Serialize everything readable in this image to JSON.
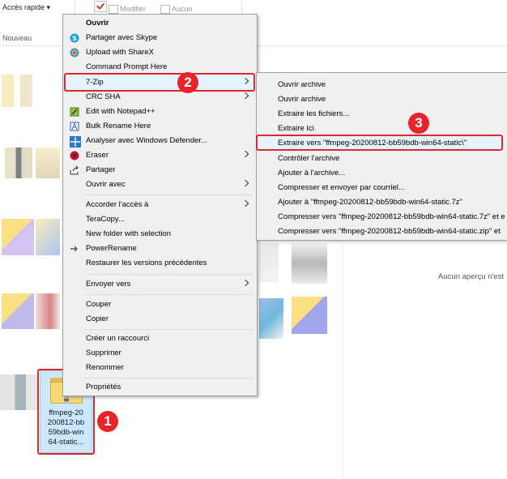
{
  "ribbon": {
    "quick_access": "Accès rapide ▾",
    "group_new": "Nouveau",
    "modifier": "Modifier",
    "aucun": "Aucun"
  },
  "preview": {
    "text": "Aucun aperçu n'est"
  },
  "selected_file": {
    "name_lines": [
      "ffmpeg-20",
      "200812-bb",
      "59bdb-win",
      "64-static..."
    ]
  },
  "badges": [
    "1",
    "2",
    "3"
  ],
  "context_menu": {
    "items": [
      {
        "label": "Ouvrir",
        "icon": "none",
        "bold": true
      },
      {
        "label": "Partager avec Skype",
        "icon": "skype-icon"
      },
      {
        "label": "Upload with ShareX",
        "icon": "sharex-icon"
      },
      {
        "label": "Command Prompt Here",
        "icon": "none"
      },
      {
        "label": "7-Zip",
        "icon": "none",
        "submenu": true
      },
      {
        "label": "CRC SHA",
        "icon": "none",
        "submenu": true
      },
      {
        "label": "Edit with Notepad++",
        "icon": "notepad-icon"
      },
      {
        "label": "Bulk Rename Here",
        "icon": "bulk-rename-icon"
      },
      {
        "label": "Analyser avec Windows Defender...",
        "icon": "defender-icon"
      },
      {
        "label": "Eraser",
        "icon": "eraser-icon",
        "submenu": true
      },
      {
        "label": "Partager",
        "icon": "share-icon"
      },
      {
        "label": "Ouvrir avec",
        "icon": "none",
        "submenu": true
      },
      {
        "label": "Accorder l'accès à",
        "icon": "none",
        "submenu": true
      },
      {
        "label": "TeraCopy...",
        "icon": "none"
      },
      {
        "label": "New folder with selection",
        "icon": "none"
      },
      {
        "label": "PowerRename",
        "icon": "powerrename-icon"
      },
      {
        "label": "Restaurer les versions précédentes",
        "icon": "none"
      },
      {
        "label": "Envoyer vers",
        "icon": "none",
        "submenu": true
      },
      {
        "label": "Couper",
        "icon": "none"
      },
      {
        "label": "Copier",
        "icon": "none"
      },
      {
        "label": "Créer un raccourci",
        "icon": "none"
      },
      {
        "label": "Supprimer",
        "icon": "none"
      },
      {
        "label": "Renommer",
        "icon": "none"
      },
      {
        "label": "Propriétés",
        "icon": "none"
      }
    ]
  },
  "submenu_7zip": {
    "items": [
      "Ouvrir archive",
      "Ouvrir archive",
      "Extraire les fichiers...",
      "Extraire Ici",
      "Extraire vers \"ffmpeg-20200812-bb59bdb-win64-static\\\"",
      "Contrôler l'archive",
      "Ajouter à l'archive...",
      "Compresser et envoyer par courriel...",
      "Ajouter à \"ffmpeg-20200812-bb59bdb-win64-static.7z\"",
      "Compresser vers \"ffmpeg-20200812-bb59bdb-win64-static.7z\" et e",
      "Compresser vers \"ffmpeg-20200812-bb59bdb-win64-static.zip\" et"
    ]
  },
  "colors": {
    "highlight": "#e5f3ff",
    "annotation_red": "#e8232a",
    "selection": "#cce8ff"
  }
}
